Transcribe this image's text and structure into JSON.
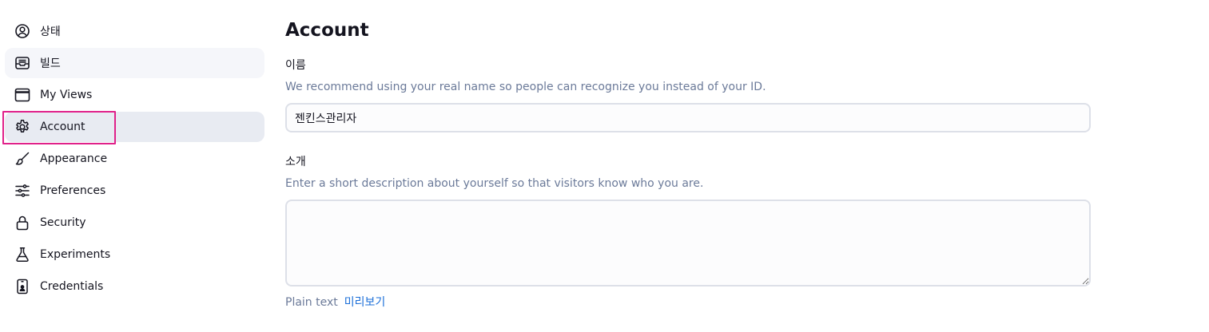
{
  "sidebar": {
    "items": [
      {
        "label": "상태",
        "icon": "user-circle-icon"
      },
      {
        "label": "빌드",
        "icon": "inbox-icon"
      },
      {
        "label": "My Views",
        "icon": "window-icon"
      },
      {
        "label": "Account",
        "icon": "gear-icon"
      },
      {
        "label": "Appearance",
        "icon": "brush-icon"
      },
      {
        "label": "Preferences",
        "icon": "sliders-icon"
      },
      {
        "label": "Security",
        "icon": "lock-icon"
      },
      {
        "label": "Experiments",
        "icon": "flask-icon"
      },
      {
        "label": "Credentials",
        "icon": "phone-id-icon"
      }
    ],
    "active": "Account",
    "highlight_color": "#e0218a"
  },
  "main": {
    "title": "Account",
    "name_field": {
      "label": "이름",
      "description": "We recommend using your real name so people can recognize you instead of your ID.",
      "value": "젠킨스관리자"
    },
    "bio_field": {
      "label": "소개",
      "description": "Enter a short description about yourself so that visitors know who you are.",
      "value": "",
      "format_label": "Plain text",
      "preview_link": "미리보기"
    }
  },
  "colors": {
    "active_bg": "#e8ebf2",
    "muted_text": "#6b7a99",
    "link": "#1a6ed8"
  }
}
